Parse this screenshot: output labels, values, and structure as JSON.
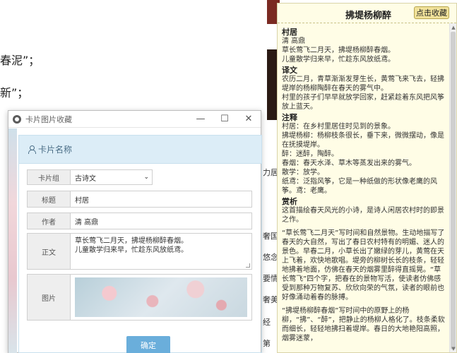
{
  "background": {
    "line1": "春泥”；",
    "line2": "新”；",
    "mid_items": [
      "力居",
      "奢国",
      "悠念",
      "要情",
      "奢美",
      "经",
      "第"
    ]
  },
  "dialog": {
    "title": "卡片图片收藏",
    "controls": {
      "min": "—",
      "max": "☐",
      "close": "✕"
    },
    "card_header": "卡片名称",
    "fields": {
      "group_label": "卡片组",
      "group_value": "古诗文",
      "title_label": "标题",
      "title_value": "村居",
      "author_label": "作者",
      "author_value": "清 高鼎",
      "body_label": "正文",
      "body_lines": [
        "草长莺飞二月天，拂堤杨柳醉春烟。",
        "儿童散学归来早，忙趁东风放纸鸢。"
      ],
      "image_label": "图片"
    },
    "ok_label": "确定"
  },
  "panel": {
    "title": "拂堤杨柳醉",
    "collect_label": "点击收藏",
    "sections": [
      {
        "head": "村居",
        "lines": [
          "清 高鼎",
          "草长莺飞二月天，拂堤杨柳醉春烟。",
          "儿童散学归来早，忙趁东风放纸鸢。"
        ]
      },
      {
        "head": "译文",
        "lines": [
          "农历二月，青草渐渐发芽生长，黄莺飞来飞去，轻拂堤岸的杨柳陶醉在春天的雾气中。",
          "村里的孩子们早早就放学回家，赶紧趁着东风把风筝放上蓝天。"
        ]
      },
      {
        "head": "注释",
        "lines": [
          "村居：在乡村里居住时见到的景象。",
          "拂堤杨柳：杨柳枝条很长，垂下来，微微摆动，像是在抚摸堤岸。",
          "醉：迷醉，陶醉。",
          "春烟：春天水泽、草木等蒸发出来的雾气。",
          "散学：放学。",
          "纸鸢：泛指风筝，它是一种纸做的形状像老鹰的风筝。鸢：老鹰。"
        ]
      },
      {
        "head": "赏析",
        "lines": [
          "这首描绘春天风光的小诗，是诗人闲居农村时的即景之作。",
          "",
          "“草长莺飞二月天”写时间和自然景物。生动地描写了春天的大自然，写出了春日农村特有的明媚、迷人的景色。早春二月，小草长出了嫩绿的芽儿，黄莺在天上飞着，欢快地歌唱。堤旁的柳树长长的枝条，轻轻地拂着地面，仿佛在春天的烟雾里醉得直摇晃。“草长莺飞”四个字，把春在的景物写活，使读者仿佛感受到那种万物复苏、欣欣向荣的气氛，读者的眼前也好像涌动着春的脉搏。",
          "",
          "“拂堤杨柳醉春烟”写时间中的原野上的杨柳，“拂”、“醉”，把静止的杨柳人格化了。枝条柔软而细长，轻轻地拂扫着堤岸。春日的大地艳阳高照，烟雾迷蒙，"
        ]
      }
    ]
  }
}
